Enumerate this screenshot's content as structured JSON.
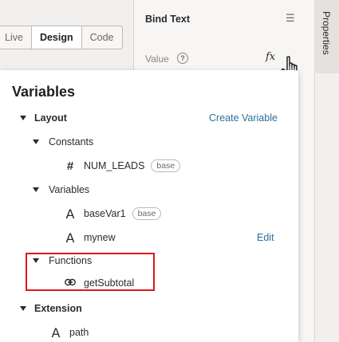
{
  "toolbar": {
    "modes": [
      {
        "label": "Live",
        "active": false
      },
      {
        "label": "Design",
        "active": true
      },
      {
        "label": "Code",
        "active": false
      }
    ]
  },
  "properties_panel": {
    "title": "Bind Text",
    "value_label": "Value",
    "tab_label": "Properties",
    "fx_label": "fx"
  },
  "variables_popup": {
    "title": "Variables",
    "layout_label": "Layout",
    "create_variable_label": "Create Variable",
    "constants_label": "Constants",
    "constant_item": {
      "name": "NUM_LEADS",
      "badge": "base"
    },
    "variables_label": "Variables",
    "variable_items": [
      {
        "name": "baseVar1",
        "badge": "base"
      },
      {
        "name": "mynew",
        "action": "Edit"
      }
    ],
    "functions_label": "Functions",
    "function_item": {
      "name": "getSubtotal"
    },
    "extension_label": "Extension",
    "extension_item": {
      "name": "path"
    }
  },
  "colors": {
    "accent_link": "#2b6f9c",
    "highlight_box": "#e0171b"
  }
}
